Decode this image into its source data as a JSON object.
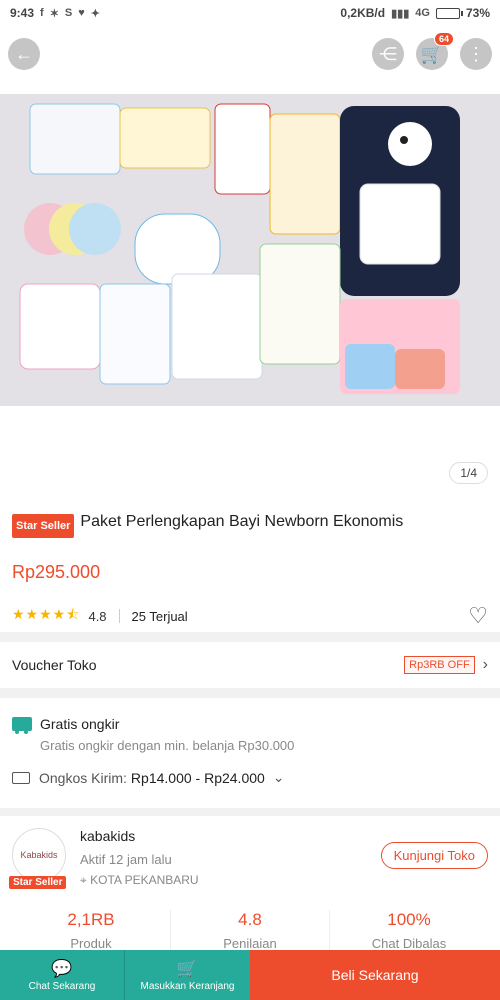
{
  "status_bar": {
    "time": "9:43",
    "left_icons": [
      "facebook-icon",
      "settings-icon",
      "s-app-icon",
      "heart-icon",
      "twitter-icon"
    ],
    "network_speed": "0,2KB/d",
    "network_type": "4G",
    "battery": "73%",
    "battery_level": 0.73
  },
  "header": {
    "back_icon": "back-arrow-icon",
    "share_icon": "share-icon",
    "cart_icon": "cart-icon",
    "cart_badge": "64",
    "more_icon": "more-vertical-icon"
  },
  "gallery": {
    "counter": "1/4"
  },
  "product": {
    "badge": "Star Seller",
    "title": "Paket Perlengkapan Bayi Newborn Ekonomis",
    "price": "Rp295.000",
    "rating_value": 4.8,
    "rating_text": "4.8",
    "sold": "25 Terjual"
  },
  "voucher": {
    "label": "Voucher Toko",
    "tag": "Rp3RB OFF"
  },
  "shipping": {
    "free_label": "Gratis ongkir",
    "free_sub": "Gratis ongkir dengan min. belanja Rp30.000",
    "cost_label": "Ongkos Kirim:",
    "cost_value": "Rp14.000 - Rp24.000"
  },
  "shop": {
    "avatar_text": "Kabakids",
    "badge": "Star Seller",
    "name": "kabakids",
    "active": "Aktif 12 jam lalu",
    "location": "KOTA PEKANBARU",
    "visit_button": "Kunjungi Toko",
    "stats": [
      {
        "value": "2,1RB",
        "label": "Produk"
      },
      {
        "value": "4.8",
        "label": "Penilaian"
      },
      {
        "value": "100%",
        "label": "Chat Dibalas"
      }
    ]
  },
  "bottom_bar": {
    "chat": "Chat Sekarang",
    "add_cart": "Masukkan Keranjang",
    "buy": "Beli Sekarang"
  },
  "colors": {
    "accent": "#ee4d2d",
    "teal": "#26aa99",
    "star": "#f7b500"
  }
}
